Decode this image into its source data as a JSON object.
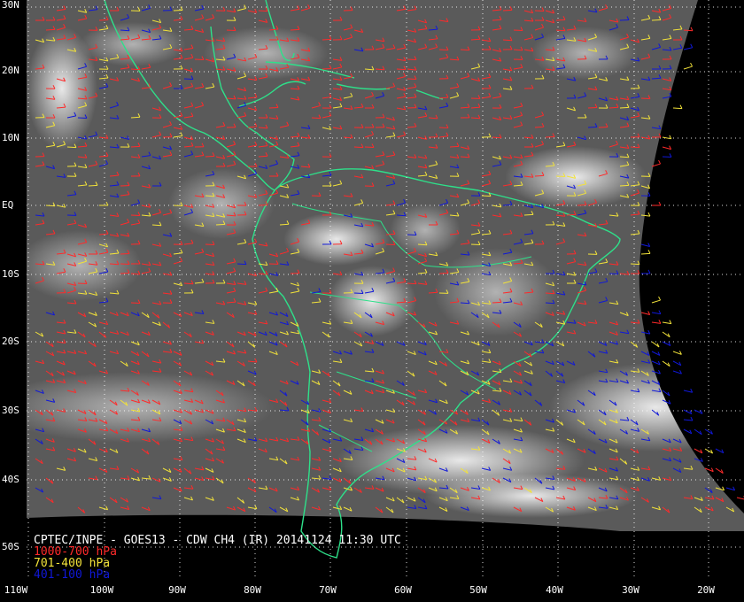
{
  "image_title": "CPTEC/INPE - GOES13 - CDW CH4 (IR) 20141124 11:30 UTC",
  "legend": [
    {
      "label": "1000-700 hPa",
      "color": "#ff2a2a"
    },
    {
      "label": "701-400 hPa",
      "color": "#f2e23a"
    },
    {
      "label": "401-100 hPa",
      "color": "#1018d8"
    }
  ],
  "latitude_labels": [
    "30N",
    "20N",
    "10N",
    "EQ",
    "10S",
    "20S",
    "30S",
    "40S",
    "50S"
  ],
  "longitude_labels": [
    "110W",
    "100W",
    "90W",
    "80W",
    "70W",
    "60W",
    "50W",
    "40W",
    "30W",
    "20W"
  ],
  "colors": {
    "background": "#000000",
    "coastline": "#2ee08a",
    "grid": "#ffffff",
    "label_text": "#ffffff"
  },
  "map": {
    "projection": "GOES-13 full disk sector, infrared channel 4",
    "lat_range": [
      -55,
      30
    ],
    "lon_range": [
      -110,
      -15
    ],
    "grid_spacing_deg": 10
  }
}
